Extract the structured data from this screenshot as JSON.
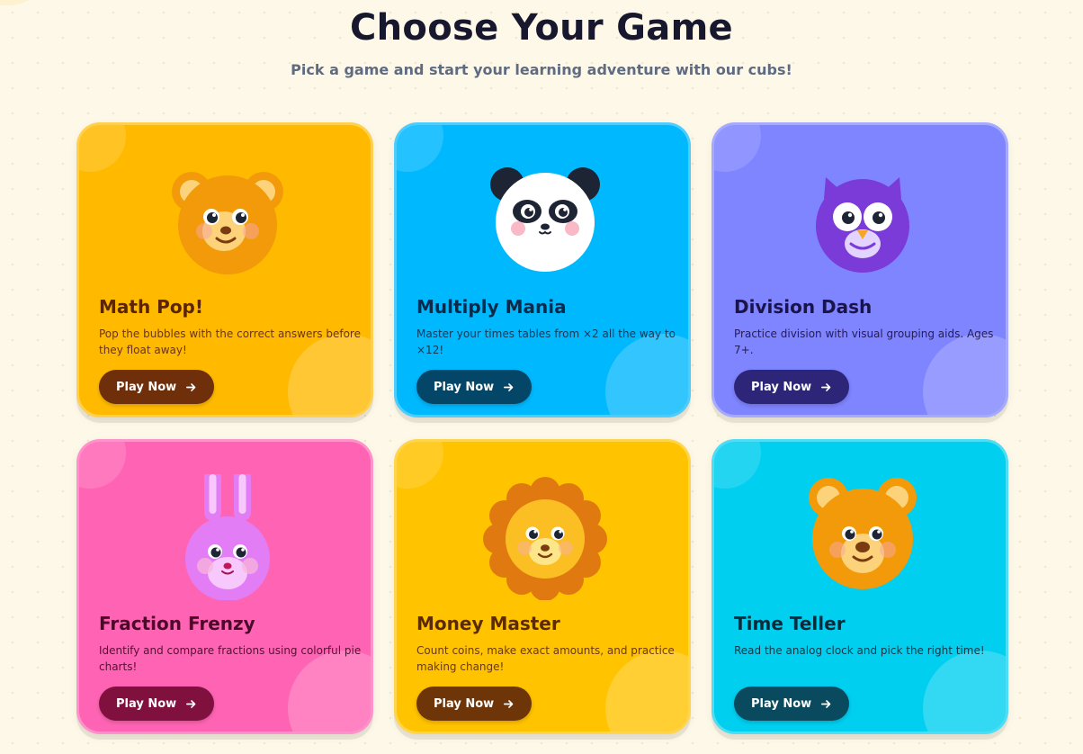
{
  "page": {
    "title": "Choose Your Game",
    "subtitle": "Pick a game and start your learning adventure with our cubs!"
  },
  "games": [
    {
      "title": "Math Pop!",
      "description": "Pop the bubbles with the correct answers before they float away!",
      "button_label": "Play Now",
      "mascot_icon": "bear-icon",
      "colors": {
        "card": "#ffba00",
        "title": "#5a2405",
        "text": "#6b3410",
        "button": "#6e2f0a"
      }
    },
    {
      "title": "Multiply Mania",
      "description": "Master your times tables from ×2 all the way to ×12!",
      "button_label": "Play Now",
      "mascot_icon": "panda-icon",
      "colors": {
        "card": "#00b8fe",
        "title": "#0a2a4a",
        "text": "#123a5a",
        "button": "#044668"
      }
    },
    {
      "title": "Division Dash",
      "description": "Practice division with visual grouping aids. Ages 7+.",
      "button_label": "Play Now",
      "mascot_icon": "owl-icon",
      "colors": {
        "card": "#7f84ff",
        "title": "#1a1448",
        "text": "#241c5a",
        "button": "#2c2578"
      }
    },
    {
      "title": "Fraction Frenzy",
      "description": "Identify and compare fractions using colorful pie charts!",
      "button_label": "Play Now",
      "mascot_icon": "bunny-icon",
      "colors": {
        "card": "#ff64b4",
        "title": "#4a0a28",
        "text": "#5a0e34",
        "button": "#80113f"
      }
    },
    {
      "title": "Money Master",
      "description": "Count coins, make exact amounts, and practice making change!",
      "button_label": "Play Now",
      "mascot_icon": "lion-icon",
      "colors": {
        "card": "#ffc300",
        "title": "#5a2a05",
        "text": "#6b3a10",
        "button": "#6e3508"
      }
    },
    {
      "title": "Time Teller",
      "description": "Read the analog clock and pick the right time!",
      "button_label": "Play Now",
      "mascot_icon": "bear-cub-icon",
      "colors": {
        "card": "#00cff0",
        "title": "#0a2a3a",
        "text": "#0f3a4a",
        "button": "#0a4a5e"
      }
    }
  ]
}
